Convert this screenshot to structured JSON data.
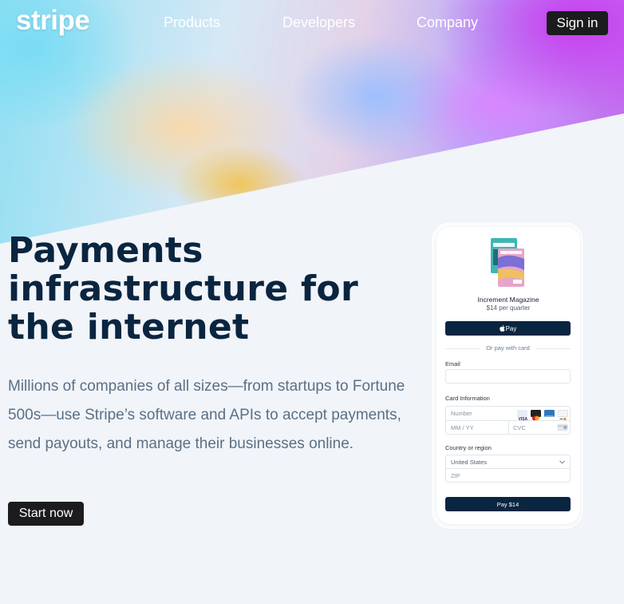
{
  "nav": {
    "logo": "stripe",
    "links": [
      "Products",
      "Developers",
      "Company"
    ],
    "sign_in": "Sign in"
  },
  "hero": {
    "headline_lines": [
      "Payments",
      "infrastructure for",
      "the internet"
    ],
    "subtext": "Millions of companies of all sizes—from startups to Fortune 500s—use Stripe’s software and APIs to accept payments, send payouts, and manage their businesses online.",
    "cta": "Start now"
  },
  "checkout": {
    "product_name": "Increment Magazine",
    "product_price": "$14 per quarter",
    "apple_pay_label": "Pay",
    "or_text": "Or pay with card",
    "email_label": "Email",
    "email_value": "",
    "card_label": "Card Information",
    "card_number_placeholder": "Number",
    "expiry_placeholder": "MM / YY",
    "cvc_placeholder": "CVC",
    "card_brands": [
      "visa-icon",
      "mastercard-icon",
      "amex-icon",
      "discover-icon"
    ],
    "country_label": "Country or region",
    "country_value": "United States",
    "zip_placeholder": "ZIP",
    "pay_button": "Pay $14"
  },
  "colors": {
    "navy": "#0a2540",
    "button_dark": "#1c1c1e",
    "page_bg": "#f1f4f8",
    "subtext": "#5a7087"
  }
}
